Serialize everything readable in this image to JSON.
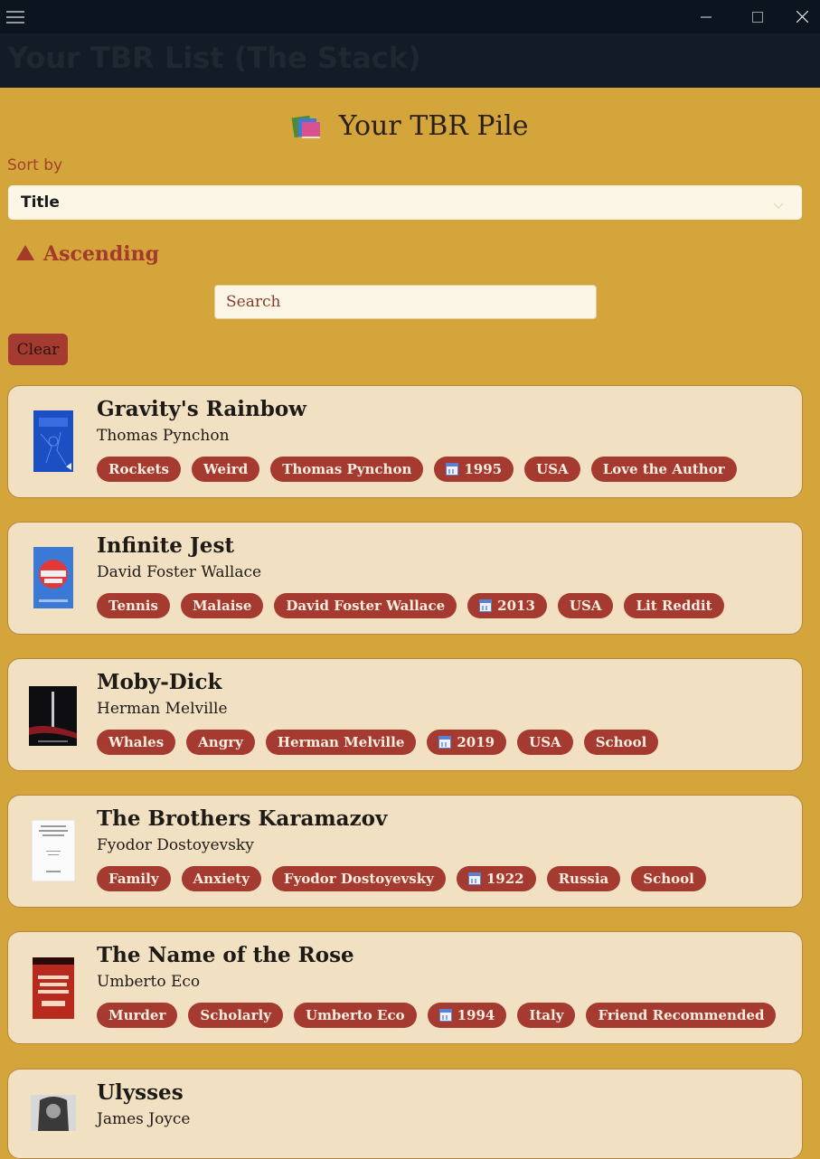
{
  "window": {
    "menu_icon": "hamburger-menu-icon",
    "minimize_icon": "minimize-icon",
    "maximize_icon": "maximize-icon",
    "close_icon": "close-icon"
  },
  "app_title": "Your TBR List (The Stack)",
  "page_heading": "Your TBR Pile",
  "page_heading_icon": "books-icon",
  "sort": {
    "label": "Sort by",
    "selected": "Title",
    "order_label": "Ascending",
    "order_icon": "triangle-up-icon"
  },
  "search": {
    "placeholder": "Search",
    "value": ""
  },
  "clear_label": "Clear",
  "colors": {
    "background": "#d4a53a",
    "card": "#f1e0c1",
    "tag": "#a53a30",
    "accent_text": "#a33a2a"
  },
  "books": [
    {
      "title": "Gravity's Rainbow",
      "author": "Thomas Pynchon",
      "tags": [
        "Rockets",
        "Weird",
        "Thomas Pynchon",
        "1995",
        "USA",
        "Love the Author"
      ],
      "year_index": 3
    },
    {
      "title": "Infinite Jest",
      "author": "David Foster Wallace",
      "tags": [
        "Tennis",
        "Malaise",
        "David Foster Wallace",
        "2013",
        "USA",
        "Lit Reddit"
      ],
      "year_index": 3
    },
    {
      "title": "Moby-Dick",
      "author": "Herman Melville",
      "tags": [
        "Whales",
        "Angry",
        "Herman Melville",
        "2019",
        "USA",
        "School"
      ],
      "year_index": 3
    },
    {
      "title": "The Brothers Karamazov",
      "author": "Fyodor Dostoyevsky",
      "tags": [
        "Family",
        "Anxiety",
        "Fyodor Dostoyevsky",
        "1922",
        "Russia",
        "School"
      ],
      "year_index": 3
    },
    {
      "title": "The Name of the Rose",
      "author": "Umberto Eco",
      "tags": [
        "Murder",
        "Scholarly",
        "Umberto Eco",
        "1994",
        "Italy",
        "Friend Recommended"
      ],
      "year_index": 3
    },
    {
      "title": "Ulysses",
      "author": "James Joyce",
      "tags": [],
      "year_index": -1
    }
  ]
}
